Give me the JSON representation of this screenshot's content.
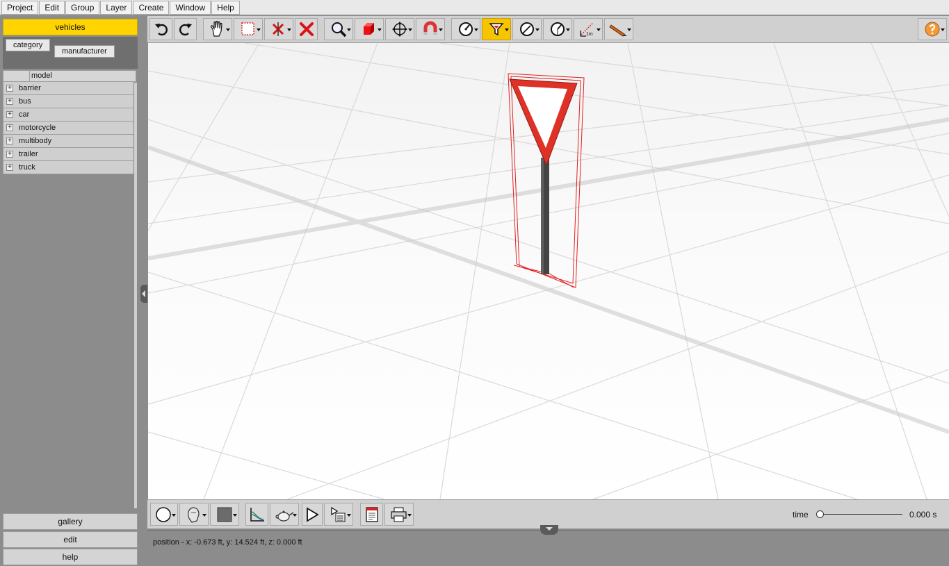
{
  "menu": [
    "Project",
    "Edit",
    "Group",
    "Layer",
    "Create",
    "Window",
    "Help"
  ],
  "sidebar": {
    "active_tab": "vehicles",
    "filters": [
      "category",
      "manufacturer"
    ],
    "column_header": "model",
    "tree_items": [
      "barrier",
      "bus",
      "car",
      "motorcycle",
      "multibody",
      "trailer",
      "truck"
    ],
    "buttons": [
      "gallery",
      "edit",
      "help"
    ]
  },
  "toolbar": {
    "icons": [
      "undo-icon",
      "redo-icon",
      "pan-hand-icon",
      "select-box-icon",
      "delete-selected-icon",
      "delete-icon",
      "zoom-icon",
      "view-cube-icon",
      "move-icon",
      "magnet-icon",
      "measure-icon",
      "filter-icon",
      "angle-icon",
      "arc-icon",
      "ruler-icon",
      "pencil-icon",
      "help-icon"
    ],
    "ruler_label": "1m",
    "active_tool": "filter-icon"
  },
  "bottom": {
    "time_label": "time",
    "time_value": "0.000 s"
  },
  "status": {
    "text": "position - x: -0.673 ft, y: 14.524 ft, z: 0.000 ft"
  },
  "colors": {
    "accent": "#ffd400",
    "sign_red": "#e03127",
    "selection": "#e02020"
  }
}
